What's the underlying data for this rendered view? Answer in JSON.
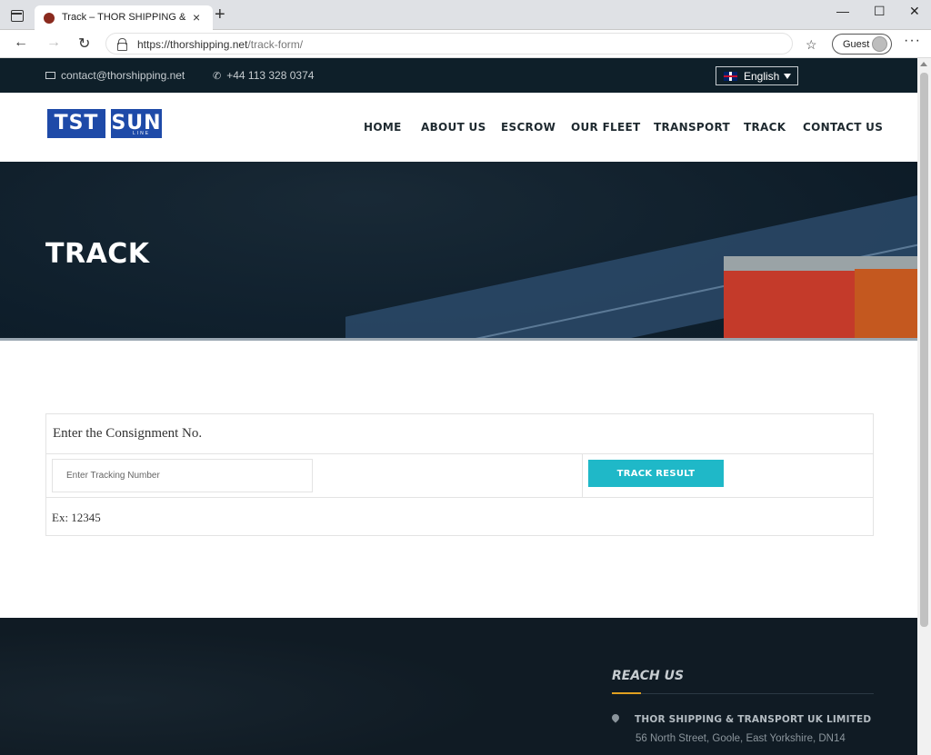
{
  "browser": {
    "tab_title": "Track – THOR SHIPPING & TRAN",
    "tab_close": "×",
    "new_tab": "+",
    "window_controls": [
      "—",
      "☐",
      "✕"
    ],
    "url_host": "https://thorshipping.net",
    "url_path": "/track-form/",
    "profile_label": "Guest",
    "more_label": "···",
    "nav_back": "←",
    "nav_forward": "→",
    "nav_reload": "↻",
    "favorites_icon": "☆"
  },
  "topbar": {
    "email": "contact@thorshipping.net",
    "phone": "+44 113 328 0374",
    "language": "English"
  },
  "header": {
    "logo_left": "TST",
    "logo_right": "SUN",
    "logo_sub": "LINE",
    "nav": [
      "HOME",
      "ABOUT US",
      "ESCROW",
      "OUR FLEET",
      "TRANSPORT",
      "TRACK",
      "CONTACT US"
    ]
  },
  "hero": {
    "title": "TRACK"
  },
  "track_form": {
    "heading": "Enter the Consignment No.",
    "input_placeholder": "Enter Tracking Number",
    "input_value": "",
    "button_label": "TRACK RESULT",
    "example": "Ex: 12345"
  },
  "footer": {
    "heading": "REACH US",
    "company": "THOR SHIPPING & TRANSPORT UK LIMITED",
    "address": "56 North Street, Goole, East Yorkshire, DN14"
  },
  "colors": {
    "topbar_bg": "#0e1f29",
    "logo_blue": "#1e4aa8",
    "button_teal": "#1fb8c8",
    "footer_bg": "#101b24",
    "footer_accent": "#e0a020"
  }
}
